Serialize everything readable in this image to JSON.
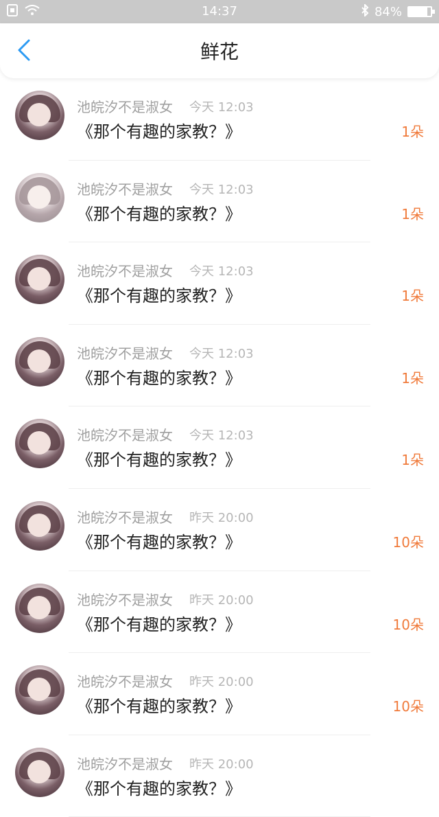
{
  "status_bar": {
    "time": "14:37",
    "battery": "84%",
    "battery_level": 0.84,
    "icons": [
      "sim-icon",
      "wifi-icon",
      "bluetooth-icon",
      "battery-icon"
    ]
  },
  "nav": {
    "title": "鲜花",
    "back_icon": "chevron-left-icon",
    "accent": "#2b9af3"
  },
  "items": [
    {
      "name": "池皖汐不是淑女",
      "time": "今天 12:03",
      "book": "《那个有趣的家教？》",
      "count": "1朵"
    },
    {
      "name": "池皖汐不是淑女",
      "time": "今天 12:03",
      "book": "《那个有趣的家教？》",
      "count": "1朵"
    },
    {
      "name": "池皖汐不是淑女",
      "time": "今天 12:03",
      "book": "《那个有趣的家教？》",
      "count": "1朵"
    },
    {
      "name": "池皖汐不是淑女",
      "time": "今天 12:03",
      "book": "《那个有趣的家教？》",
      "count": "1朵"
    },
    {
      "name": "池皖汐不是淑女",
      "time": "今天 12:03",
      "book": "《那个有趣的家教？》",
      "count": "1朵"
    },
    {
      "name": "池皖汐不是淑女",
      "time": "昨天 20:00",
      "book": "《那个有趣的家教？》",
      "count": "10朵"
    },
    {
      "name": "池皖汐不是淑女",
      "time": "昨天 20:00",
      "book": "《那个有趣的家教？》",
      "count": "10朵"
    },
    {
      "name": "池皖汐不是淑女",
      "time": "昨天 20:00",
      "book": "《那个有趣的家教？》",
      "count": "10朵"
    },
    {
      "name": "池皖汐不是淑女",
      "time": "昨天 20:00",
      "book": "《那个有趣的家教？》",
      "count": ""
    }
  ],
  "colors": {
    "count": "#f07a3a",
    "name": "#a0a0a0",
    "time": "#b6b6b6",
    "status_bar": "#c9c9c9"
  }
}
